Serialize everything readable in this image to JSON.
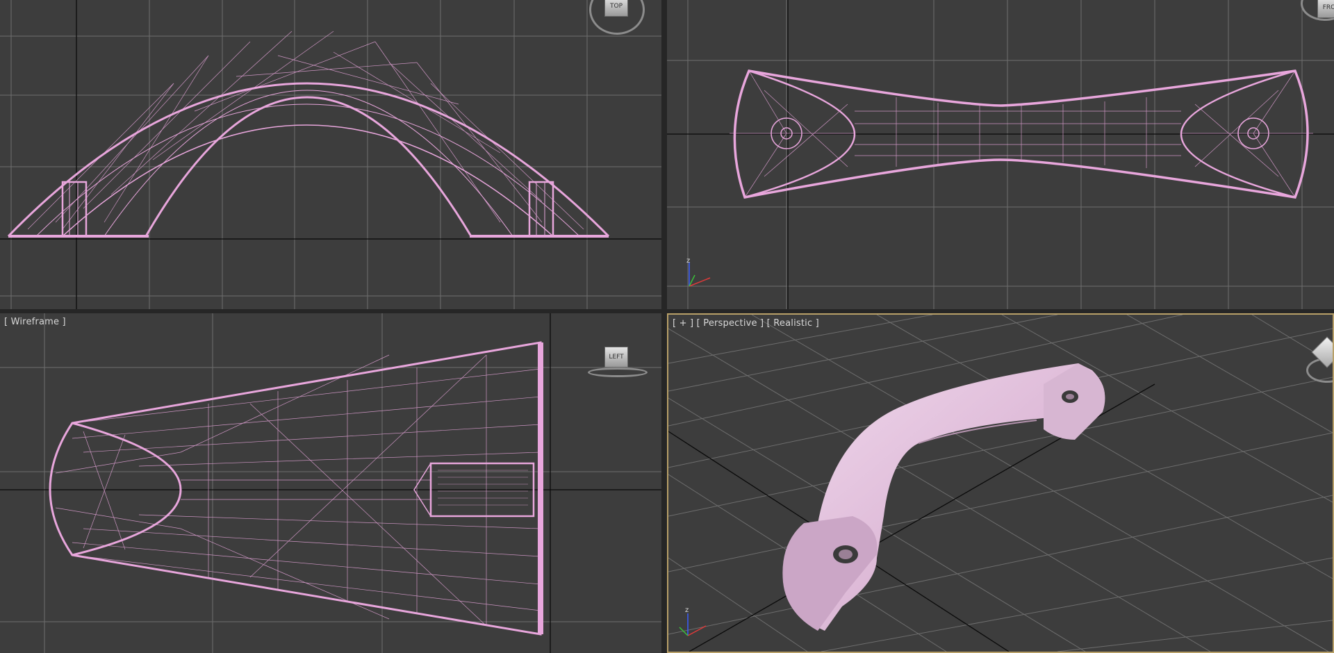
{
  "viewports": {
    "top": {
      "viewcube_label": "TOP"
    },
    "front": {
      "viewcube_label": "FRO",
      "axis_label": "z"
    },
    "left": {
      "label": "[ Wireframe ]",
      "viewcube_label": "LEFT"
    },
    "perspective": {
      "label": "[ + ] [ Perspective ] [ Realistic ]",
      "axis_label": "z"
    }
  },
  "colors": {
    "viewport_bg": "#3d3d3d",
    "grid": "#6e6e6e",
    "axis_line": "#0a0a0a",
    "wireframe": "#e8a6dc",
    "shaded_object": "#e7c6e2",
    "active_border": "#b8a068"
  }
}
